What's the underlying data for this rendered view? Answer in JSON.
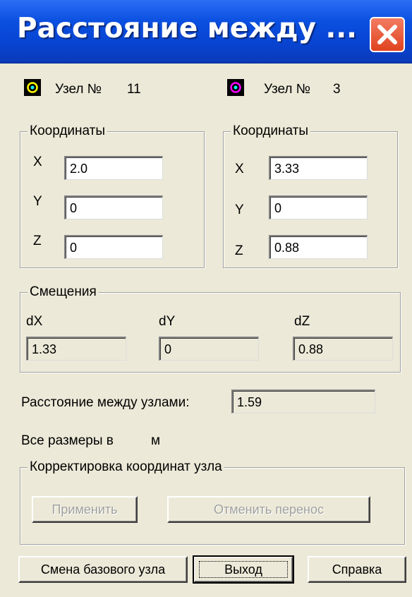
{
  "window": {
    "title": "Расстояние между ..."
  },
  "node1": {
    "label": "Узел №",
    "number": "11"
  },
  "node2": {
    "label": "Узел №",
    "number": "3"
  },
  "coords1": {
    "legend": "Координаты",
    "x_label": "X",
    "y_label": "Y",
    "z_label": "Z",
    "x": "2.0",
    "y": "0",
    "z": "0"
  },
  "coords2": {
    "legend": "Координаты",
    "x_label": "X",
    "y_label": "Y",
    "z_label": "Z",
    "x": "3.33",
    "y": "0",
    "z": "0.88"
  },
  "offsets": {
    "legend": "Смещения",
    "dx_label": "dX",
    "dy_label": "dY",
    "dz_label": "dZ",
    "dx": "1.33",
    "dy": "0",
    "dz": "0.88"
  },
  "distance": {
    "label": "Расстояние между узлами:",
    "value": "1.59"
  },
  "units": {
    "label": "Все размеры в",
    "value": "м"
  },
  "correction": {
    "legend": "Корректировка координат узла",
    "apply_label": "Применить",
    "cancel_label": "Отменить перенос"
  },
  "buttons": {
    "change_base": "Смена базового узла",
    "exit": "Выход",
    "help": "Справка"
  },
  "colors": {
    "title_bar": "#0a4fe0",
    "close_button": "#e0431f",
    "dialog_bg": "#ece9d8",
    "node1_icon": "#ffff00",
    "node2_icon": "#ff00ff"
  },
  "icons": {
    "close": "close-icon",
    "node1": "node-icon-yellow",
    "node2": "node-icon-magenta"
  }
}
